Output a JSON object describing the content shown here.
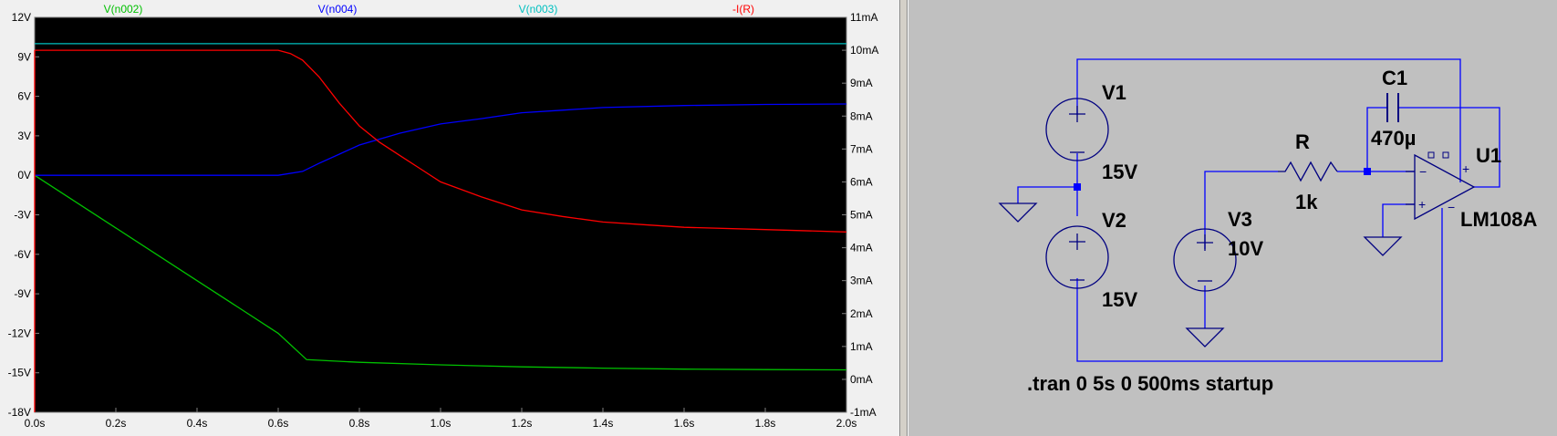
{
  "waveform": {
    "trace_labels": [
      {
        "name": "V(n002)",
        "color": "#00c000"
      },
      {
        "name": "V(n004)",
        "color": "#0000ff"
      },
      {
        "name": "V(n003)",
        "color": "#00c0c0"
      },
      {
        "name": "-I(R)",
        "color": "#ff0000"
      }
    ]
  },
  "chart_data": {
    "type": "line",
    "x_unit": "s",
    "xlim": [
      0,
      2.0
    ],
    "x_ticks": [
      "0.0s",
      "0.2s",
      "0.4s",
      "0.6s",
      "0.8s",
      "1.0s",
      "1.2s",
      "1.4s",
      "1.6s",
      "1.8s",
      "2.0s"
    ],
    "y_left_ticks": [
      "12V",
      "9V",
      "6V",
      "3V",
      "0V",
      "-3V",
      "-6V",
      "-9V",
      "-12V",
      "-15V",
      "-18V"
    ],
    "y_left_lim": [
      -18,
      12
    ],
    "y_right_ticks": [
      "11mA",
      "10mA",
      "9mA",
      "8mA",
      "7mA",
      "6mA",
      "5mA",
      "4mA",
      "3mA",
      "2mA",
      "1mA",
      "0mA",
      "-1mA"
    ],
    "y_right_lim": [
      -1,
      11
    ],
    "grid": false,
    "background": "#000000",
    "series": [
      {
        "name": "V(n002)",
        "axis": "left",
        "color": "#00c000",
        "x": [
          0,
          0.1,
          0.2,
          0.3,
          0.4,
          0.5,
          0.6,
          0.67,
          0.8,
          1.0,
          1.2,
          1.4,
          1.6,
          1.8,
          2.0
        ],
        "y": [
          0,
          -2.0,
          -4.0,
          -6.0,
          -8.0,
          -10.0,
          -12.0,
          -14.0,
          -14.2,
          -14.4,
          -14.55,
          -14.65,
          -14.72,
          -14.76,
          -14.78
        ]
      },
      {
        "name": "V(n004)",
        "axis": "left",
        "color": "#0000ff",
        "x": [
          0,
          0.6,
          0.66,
          0.7,
          0.75,
          0.8,
          0.9,
          1.0,
          1.1,
          1.2,
          1.3,
          1.4,
          1.6,
          1.8,
          2.0
        ],
        "y": [
          0,
          0,
          0.3,
          0.9,
          1.6,
          2.3,
          3.2,
          3.9,
          4.3,
          4.75,
          4.95,
          5.15,
          5.3,
          5.38,
          5.42
        ]
      },
      {
        "name": "V(n003)",
        "axis": "left",
        "color": "#00c0c0",
        "x": [
          0,
          2.0
        ],
        "y": [
          10,
          10
        ]
      },
      {
        "name": "-I(R)",
        "axis": "right",
        "color": "#ff0000",
        "x": [
          0,
          0.6,
          0.63,
          0.66,
          0.7,
          0.75,
          0.8,
          0.85,
          0.9,
          0.95,
          1.0,
          1.1,
          1.2,
          1.3,
          1.4,
          1.5,
          1.6,
          1.8,
          2.0
        ],
        "y": [
          10.0,
          10.0,
          9.9,
          9.7,
          9.2,
          8.4,
          7.7,
          7.2,
          6.8,
          6.4,
          6.0,
          5.55,
          5.15,
          4.95,
          4.78,
          4.7,
          4.62,
          4.55,
          4.48
        ]
      }
    ]
  },
  "schematic": {
    "components": [
      {
        "ref": "V1",
        "value": "15V",
        "type": "voltage-source"
      },
      {
        "ref": "V2",
        "value": "15V",
        "type": "voltage-source"
      },
      {
        "ref": "V3",
        "value": "10V",
        "type": "voltage-source"
      },
      {
        "ref": "R",
        "value": "1k",
        "type": "resistor"
      },
      {
        "ref": "C1",
        "value": "470µ",
        "type": "capacitor"
      },
      {
        "ref": "U1",
        "value": "LM108A",
        "type": "opamp"
      }
    ],
    "directive": ".tran 0 5s 0 500ms startup",
    "wire_color": "#0000ff",
    "symbol_color": "#000080"
  }
}
